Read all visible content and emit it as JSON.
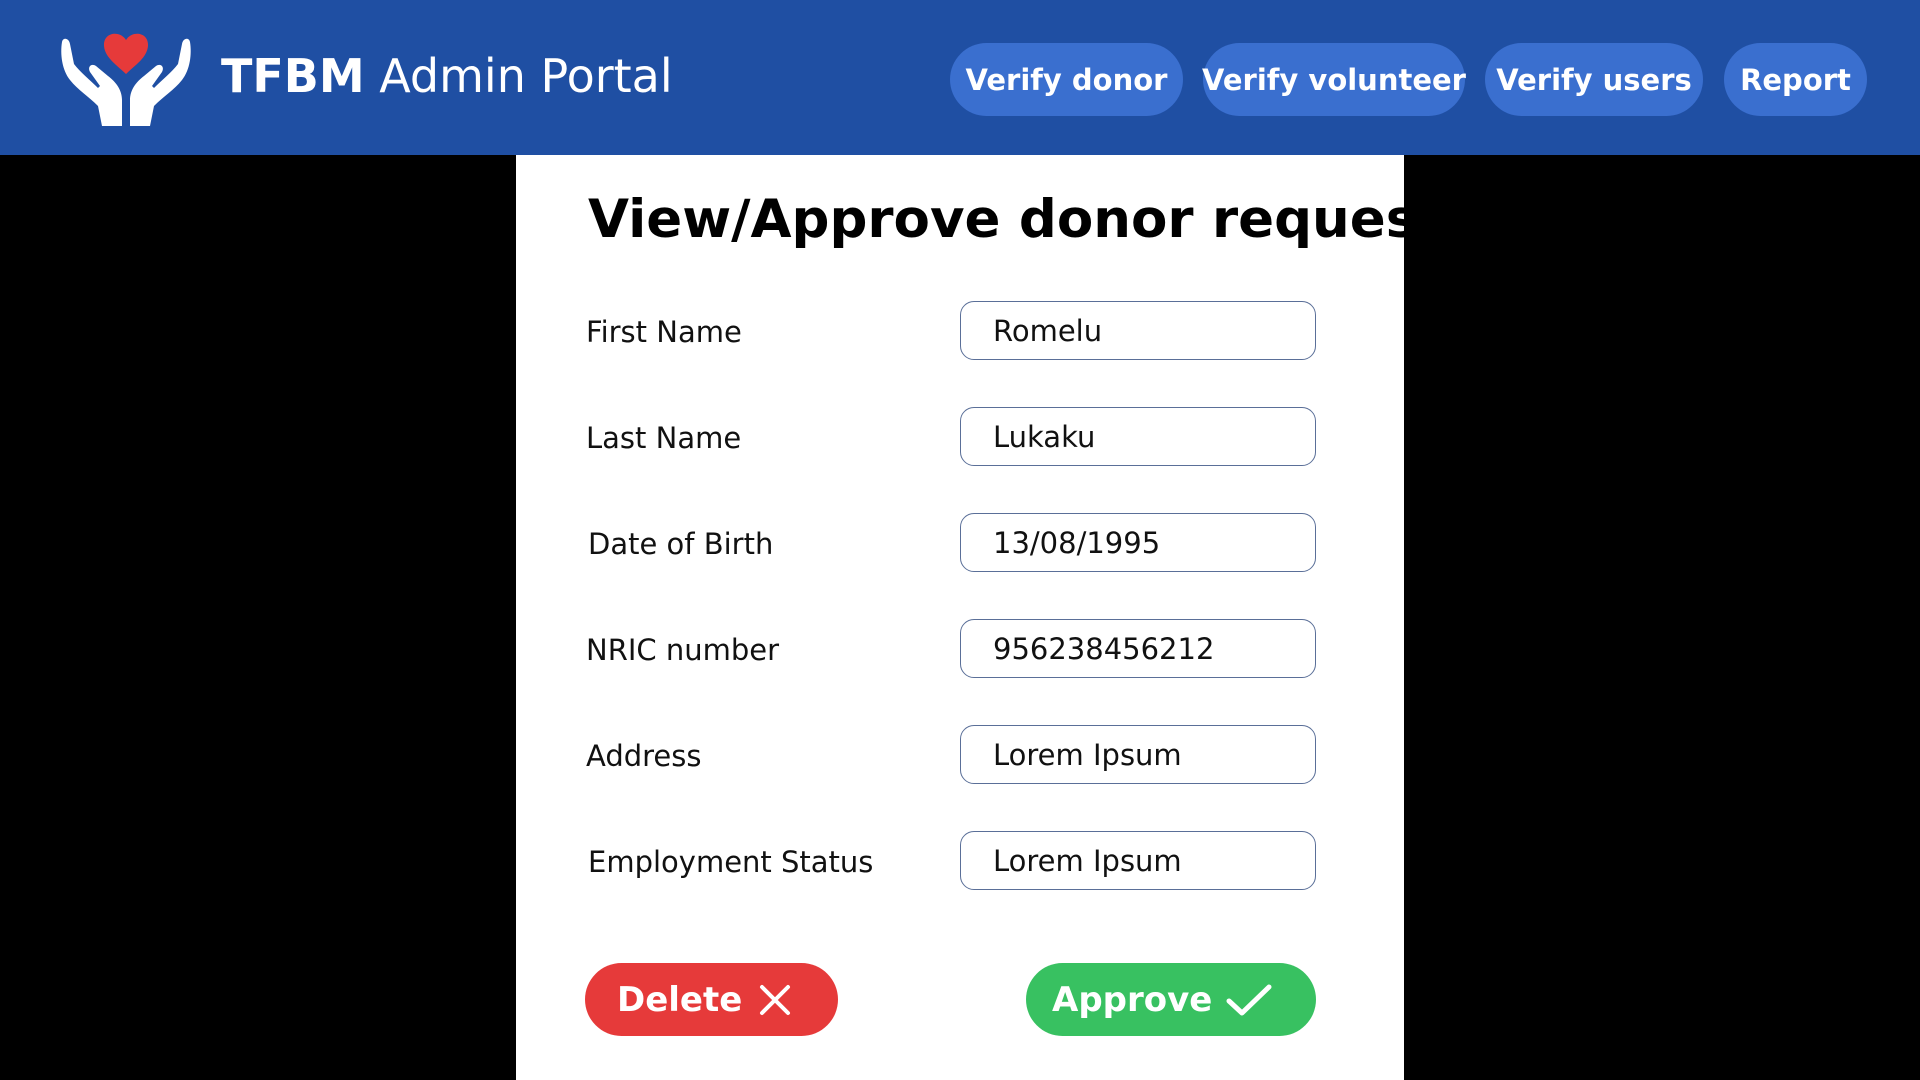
{
  "colors": {
    "header_bg": "#1f4fa3",
    "nav_button_bg": "#3a6fcf",
    "delete": "#e63a3a",
    "approve": "#38c161",
    "heart": "#e63a3a"
  },
  "header": {
    "brand_bold": "TFBM",
    "brand_rest": "Admin Portal",
    "logo_icon": "hands-heart-icon",
    "nav": [
      {
        "label": "Verify donor"
      },
      {
        "label": "Verify volunteer"
      },
      {
        "label": "Verify users"
      },
      {
        "label": "Report"
      }
    ]
  },
  "form": {
    "title": "View/Approve donor request",
    "fields": [
      {
        "label": "First Name",
        "value": "Romelu"
      },
      {
        "label": "Last Name",
        "value": "Lukaku"
      },
      {
        "label": "Date of Birth",
        "value": "13/08/1995"
      },
      {
        "label": "NRIC number",
        "value": "956238456212"
      },
      {
        "label": "Address",
        "value": "Lorem Ipsum"
      },
      {
        "label": "Employment Status",
        "value": "Lorem Ipsum"
      }
    ],
    "actions": {
      "delete_label": "Delete",
      "delete_icon": "close-icon",
      "approve_label": "Approve",
      "approve_icon": "check-icon"
    }
  }
}
